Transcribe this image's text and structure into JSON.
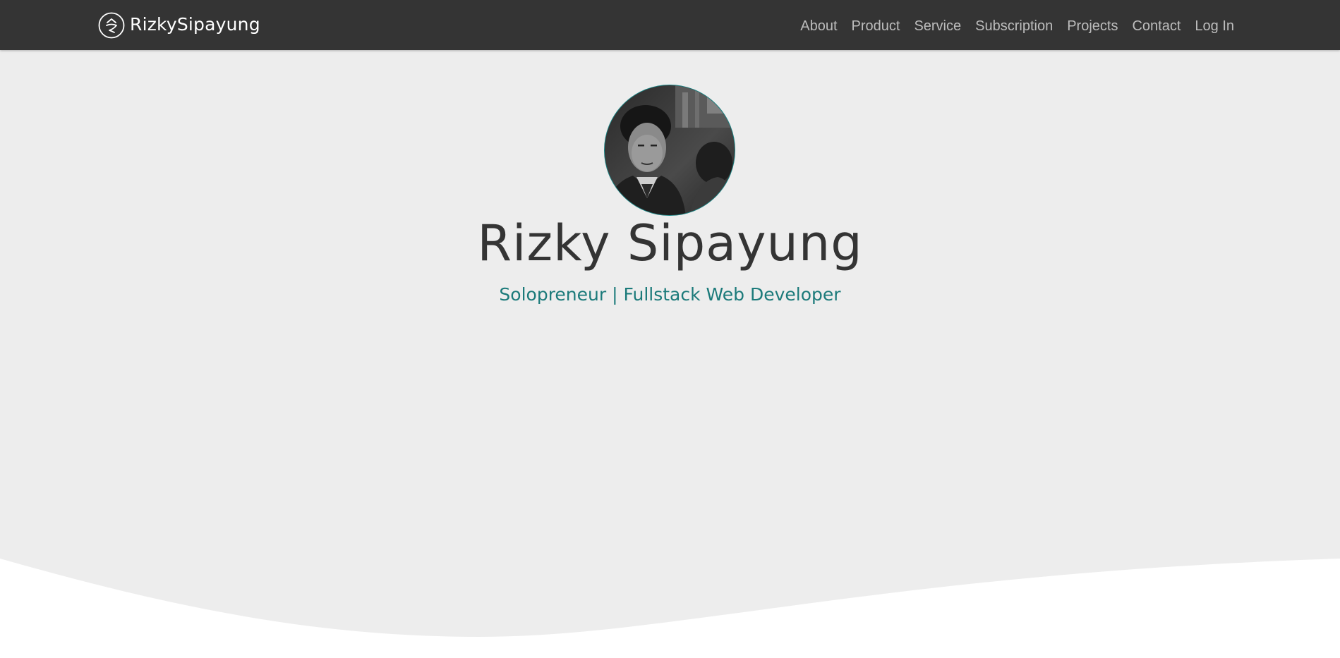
{
  "navbar": {
    "brand": "RizkySipayung",
    "brand_icon": "circle-logo-icon",
    "links": [
      "About",
      "Product",
      "Service",
      "Subscription",
      "Projects",
      "Contact",
      "Log In"
    ]
  },
  "hero": {
    "name": "Rizky Sipayung",
    "tagline": "Solopreneur | Fullstack Web Developer",
    "avatar_alt": "profile-photo"
  },
  "colors": {
    "navbar_bg": "#343434",
    "hero_bg": "#ededed",
    "accent": "#1b7a7a",
    "nav_link": "#bdbdbd"
  }
}
